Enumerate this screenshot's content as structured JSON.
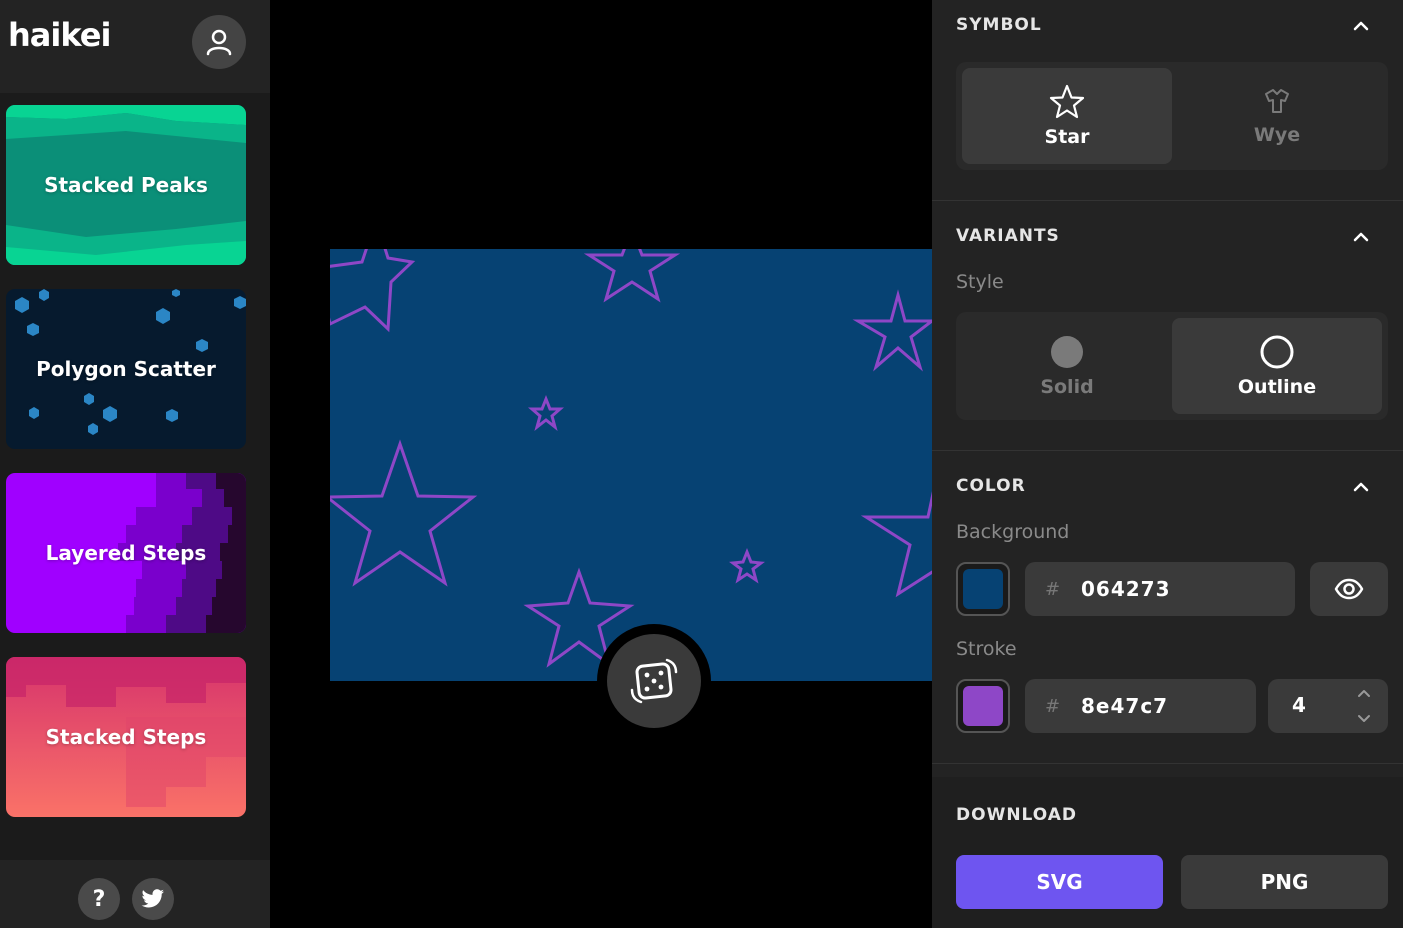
{
  "app": {
    "logo": "haikei"
  },
  "sidebar": {
    "items": [
      {
        "label": "Stacked Peaks"
      },
      {
        "label": "Polygon Scatter"
      },
      {
        "label": "Layered Steps"
      },
      {
        "label": "Stacked Steps"
      }
    ],
    "help_label": "?"
  },
  "canvas": {
    "background": "#064273",
    "stroke": "#8e47c7",
    "shape": "star-outline"
  },
  "panel": {
    "symbol": {
      "title": "SYMBOL",
      "options": [
        {
          "label": "Star",
          "icon": "star-icon",
          "selected": true
        },
        {
          "label": "Wye",
          "icon": "wye-icon",
          "selected": false
        }
      ]
    },
    "variants": {
      "title": "VARIANTS",
      "style_label": "Style",
      "options": [
        {
          "label": "Solid",
          "icon": "solid-circle-icon",
          "selected": false
        },
        {
          "label": "Outline",
          "icon": "outline-circle-icon",
          "selected": true
        }
      ]
    },
    "color": {
      "title": "COLOR",
      "background_label": "Background",
      "background_hash": "#",
      "background_hex": "064273",
      "background_color": "#064273",
      "stroke_label": "Stroke",
      "stroke_hash": "#",
      "stroke_hex": "8e47c7",
      "stroke_color": "#8e47c7",
      "stroke_width": "4"
    },
    "download": {
      "title": "DOWNLOAD",
      "svg_label": "SVG",
      "png_label": "PNG"
    }
  }
}
